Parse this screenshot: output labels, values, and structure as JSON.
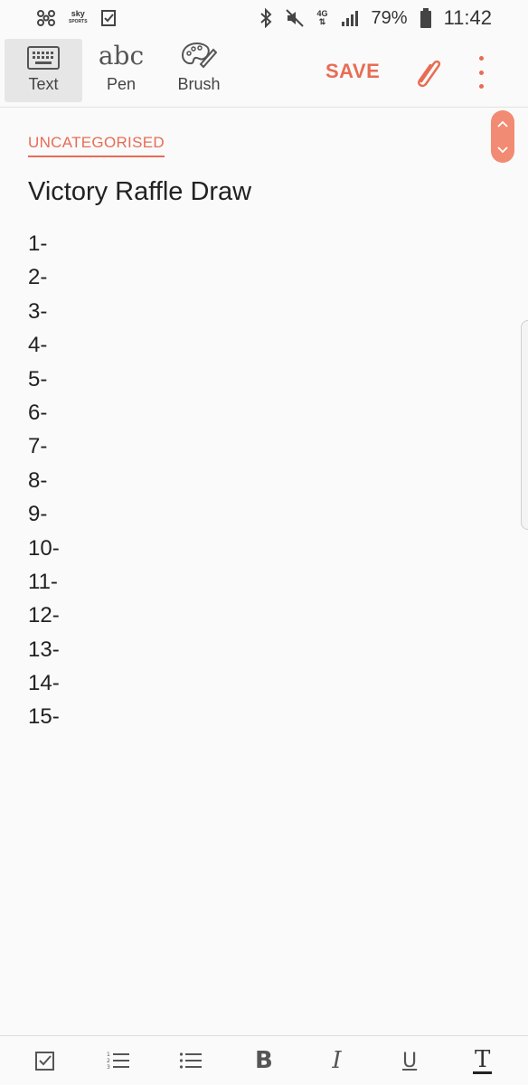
{
  "status_bar": {
    "sky_brand": "sky",
    "sky_sub": "SPORTS",
    "network": "4G",
    "battery_pct": "79%",
    "time": "11:42"
  },
  "toolbar": {
    "modes": [
      {
        "label": "Text",
        "icon": "keyboard-icon",
        "active": true
      },
      {
        "label": "Pen",
        "icon": "abc",
        "active": false
      },
      {
        "label": "Brush",
        "icon": "palette-icon",
        "active": false
      }
    ],
    "save_label": "SAVE",
    "accent": "#e86c54"
  },
  "note": {
    "category": "UNCATEGORISED",
    "title": "Victory Raffle Draw",
    "lines": [
      "1-",
      "2-",
      "3-",
      "4-",
      "5-",
      "6-",
      "7-",
      "8-",
      "9-",
      "10-",
      "11-",
      "12-",
      "13-",
      "14-",
      "15-"
    ]
  },
  "format_bar": {
    "items": [
      "checkbox-icon",
      "numbered-list-icon",
      "bulleted-list-icon",
      "bold-icon",
      "italic-icon",
      "underline-icon",
      "text-style-icon"
    ],
    "bold": "B",
    "italic": "I",
    "underline": "U",
    "text_style": "T"
  }
}
